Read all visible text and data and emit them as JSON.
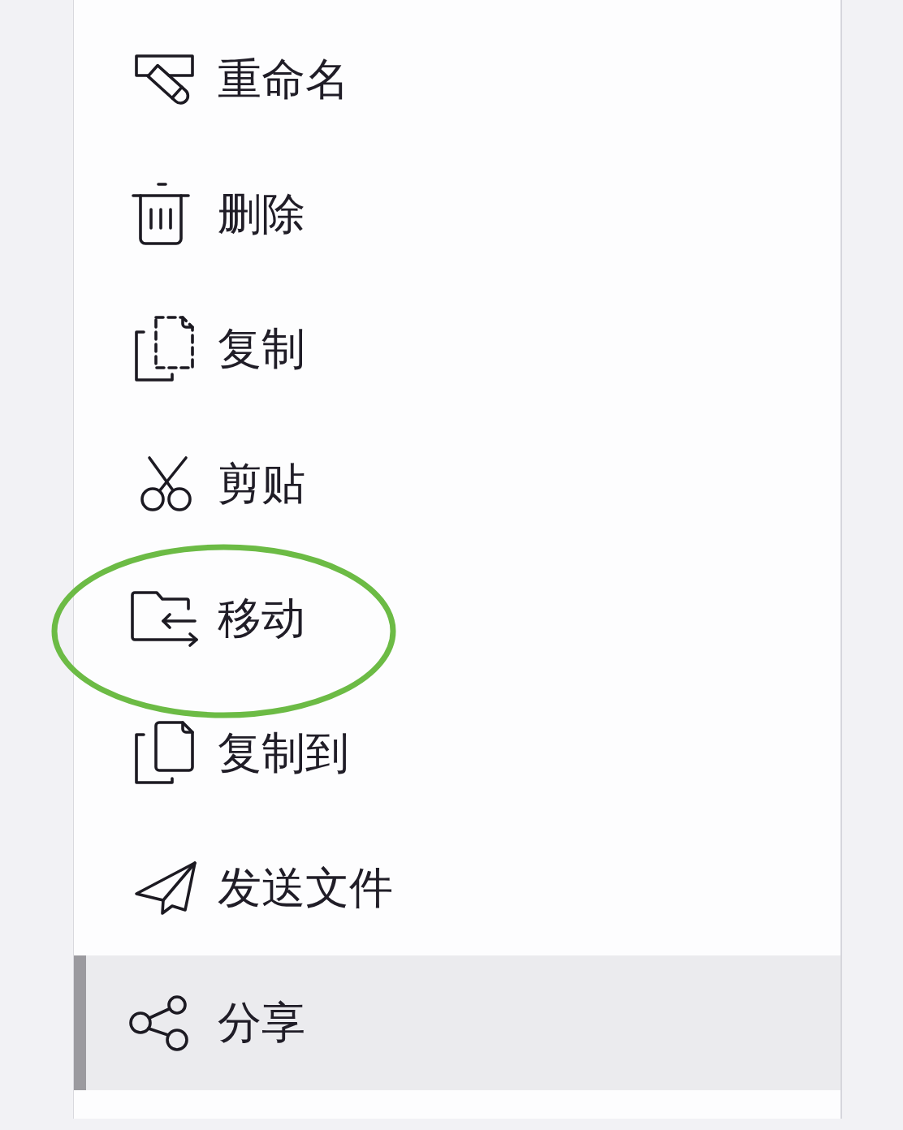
{
  "menu": {
    "items": [
      {
        "label": "重命名",
        "kind": "rename",
        "selected": false,
        "circled": false
      },
      {
        "label": "删除",
        "kind": "delete",
        "selected": false,
        "circled": false
      },
      {
        "label": "复制",
        "kind": "copy",
        "selected": false,
        "circled": false
      },
      {
        "label": "剪贴",
        "kind": "cut",
        "selected": false,
        "circled": false
      },
      {
        "label": "移动",
        "kind": "move",
        "selected": false,
        "circled": true
      },
      {
        "label": "复制到",
        "kind": "copyto",
        "selected": false,
        "circled": false
      },
      {
        "label": "发送文件",
        "kind": "send",
        "selected": false,
        "circled": false
      },
      {
        "label": "分享",
        "kind": "share",
        "selected": true,
        "circled": false
      }
    ]
  }
}
